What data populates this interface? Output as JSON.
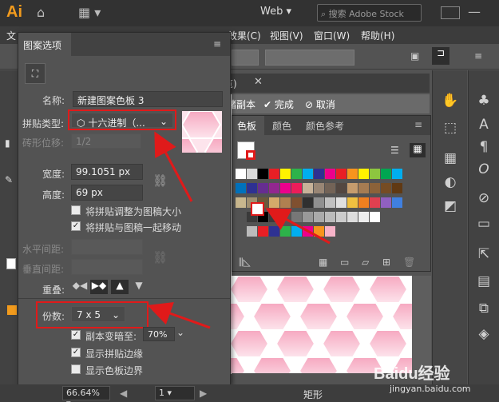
{
  "app": {
    "logo": "Ai",
    "workspace": "Web",
    "search_placeholder": "搜索 Adobe Stock"
  },
  "menu": {
    "items": [
      "文",
      "效果(C)",
      "视图(V)",
      "窗口(W)",
      "帮助(H)"
    ]
  },
  "document": {
    "tab_suffix": "览)",
    "save_copy": "储副本",
    "done": "完成",
    "cancel": "取消"
  },
  "pattern_panel": {
    "tab": "图案选项",
    "name_label": "名称:",
    "name_value": "新建图案色板 3",
    "tile_type_label": "拼贴类型:",
    "tile_type_value": "十六进制（...",
    "brick_offset_label": "砖形位移:",
    "brick_offset_value": "1/2",
    "width_label": "宽度:",
    "width_value": "99.1051 px",
    "height_label": "高度:",
    "height_value": "69 px",
    "opt_resize": "将拼贴调整为图稿大小",
    "opt_move": "将拼贴与图稿一起移动",
    "h_spacing_label": "水平间距:",
    "v_spacing_label": "垂直间距:",
    "overlap_label": "重叠:",
    "copies_label": "份数:",
    "copies_value": "7 x 5",
    "dim_copies_label": "副本变暗至:",
    "dim_copies_value": "70%",
    "show_tile_edge": "显示拼贴边缘",
    "show_swatch_bounds": "显示色板边界"
  },
  "swatches_panel": {
    "tabs": [
      "色板",
      "颜色",
      "颜色参考"
    ]
  },
  "status": {
    "zoom": "66.64%",
    "page": "1",
    "tool": "矩形"
  },
  "watermark": {
    "brand": "Baidu经验",
    "url": "jingyan.baidu.com"
  },
  "colors": {
    "accent_red": "#e01a1a",
    "logo_orange": "#f29b1d",
    "hex_pink": "#f7b3c8"
  }
}
